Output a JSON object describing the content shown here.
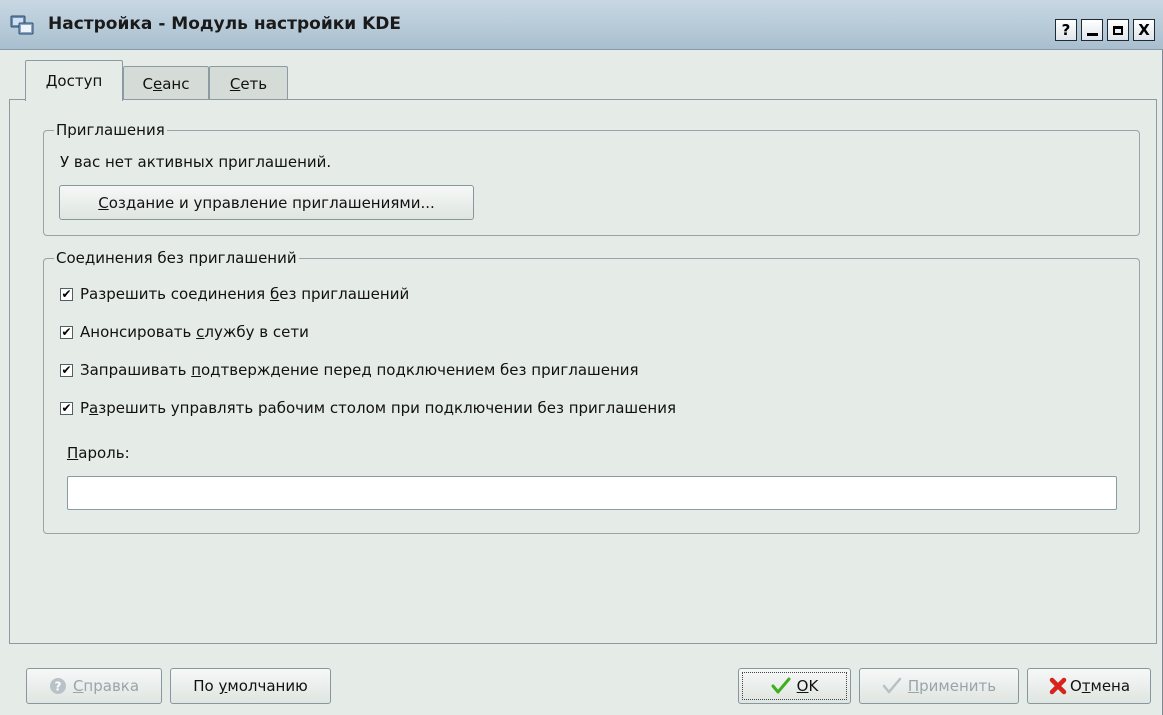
{
  "window": {
    "title": "Настройка - Модуль настройки KDE",
    "controls": {
      "help": "?",
      "minimize": "_",
      "maximize": "□",
      "close": "X"
    }
  },
  "tabs": [
    {
      "label": "Доступ",
      "mnemonic": "Д",
      "rest": "оступ",
      "active": true
    },
    {
      "label": "Сеанс",
      "before": "С",
      "mnemonic": "е",
      "rest": "анс",
      "active": false
    },
    {
      "label": "Сеть",
      "mnemonic": "С",
      "rest": "еть",
      "active": false
    }
  ],
  "invitations": {
    "group_title": "Приглашения",
    "status_text": "У вас нет активных приглашений.",
    "manage_button": {
      "mnemonic": "С",
      "rest": "оздание и управление приглашениями..."
    }
  },
  "uninvited": {
    "group_title": "Соединения без приглашений",
    "options": [
      {
        "before": "Разрешить соединения ",
        "mnemonic": "б",
        "after": "ез приглашений",
        "checked": true
      },
      {
        "before": "Анонсировать ",
        "mnemonic": "с",
        "after": "лужбу в сети",
        "checked": true
      },
      {
        "before": "Запрашивать ",
        "mnemonic": "п",
        "after": "одтверждение перед подключением без приглашения",
        "checked": true
      },
      {
        "before": "Р",
        "mnemonic": "а",
        "after": "зрешить управлять рабочим столом при подключении без приглашения",
        "checked": true
      }
    ],
    "password_label": {
      "mnemonic": "П",
      "rest": "ароль:"
    },
    "password_value": ""
  },
  "buttons": {
    "help": {
      "mnemonic": "С",
      "rest": "правка",
      "enabled": false
    },
    "defaults": {
      "before": "По ",
      "mnemonic": "у",
      "rest": "молчанию",
      "enabled": true
    },
    "ok": {
      "mnemonic": "O",
      "rest": "K",
      "enabled": true
    },
    "apply": {
      "mnemonic": "П",
      "rest": "рименить",
      "enabled": false
    },
    "cancel": {
      "before": "О",
      "mnemonic": "т",
      "rest": "мена",
      "enabled": true
    }
  },
  "checkmark": "✔",
  "colors": {
    "ok_check": "#3fae1f",
    "cancel_x": "#d8231c",
    "titlebar": "#b6c9d6"
  }
}
